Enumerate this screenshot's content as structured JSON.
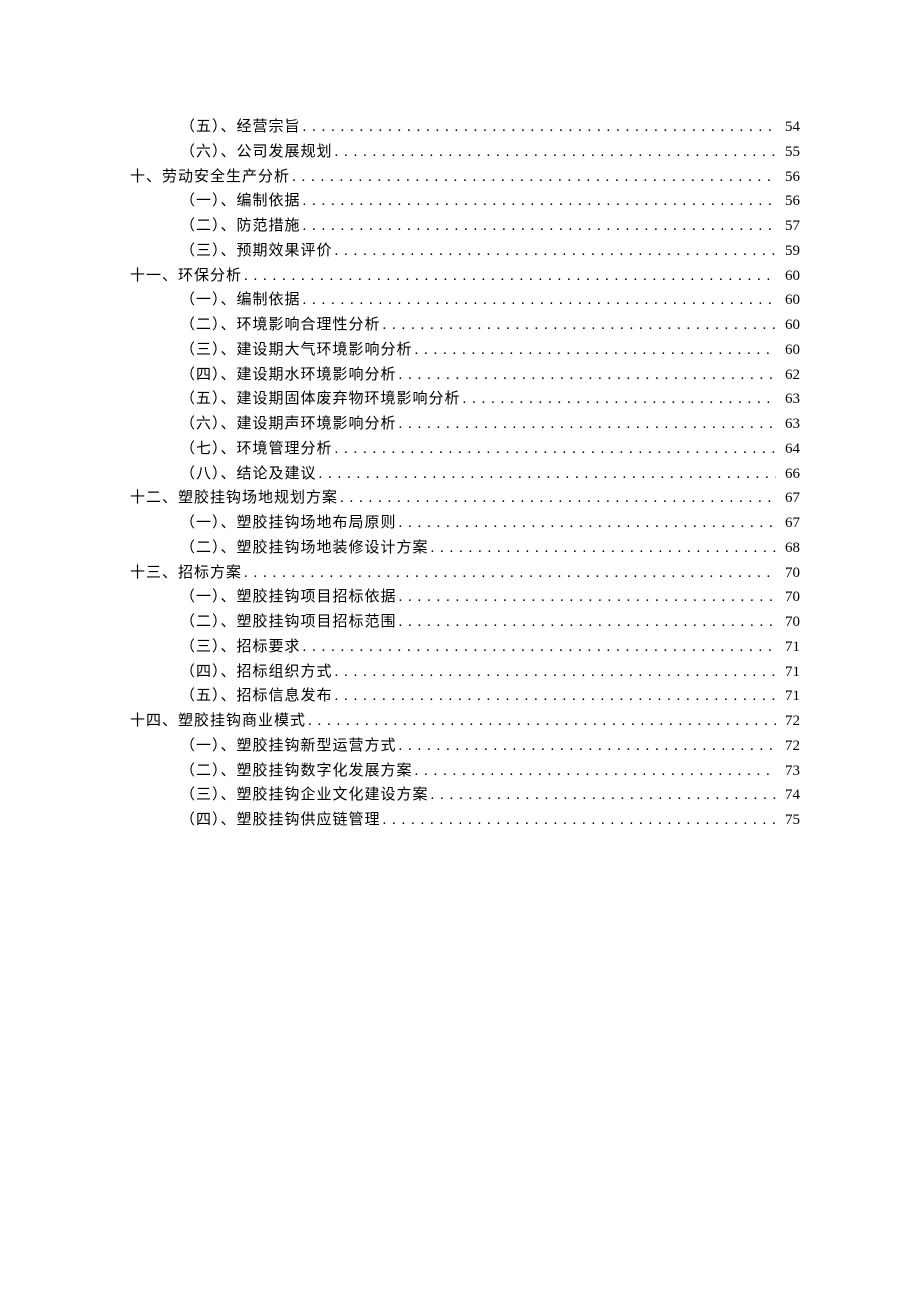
{
  "toc": [
    {
      "level": "sub",
      "label": "（五）、经营宗旨",
      "page": "54"
    },
    {
      "level": "sub",
      "label": "（六）、公司发展规划",
      "page": "55"
    },
    {
      "level": "section",
      "label": "十、劳动安全生产分析",
      "page": "56"
    },
    {
      "level": "sub",
      "label": "（一）、编制依据",
      "page": "56"
    },
    {
      "level": "sub",
      "label": "（二）、防范措施",
      "page": "57"
    },
    {
      "level": "sub",
      "label": "（三）、预期效果评价",
      "page": "59"
    },
    {
      "level": "section",
      "label": "十一、环保分析",
      "page": "60"
    },
    {
      "level": "sub",
      "label": "（一）、编制依据",
      "page": "60"
    },
    {
      "level": "sub",
      "label": "（二）、环境影响合理性分析",
      "page": "60"
    },
    {
      "level": "sub",
      "label": "（三）、建设期大气环境影响分析",
      "page": "60"
    },
    {
      "level": "sub",
      "label": "（四）、建设期水环境影响分析",
      "page": "62"
    },
    {
      "level": "sub",
      "label": "（五）、建设期固体废弃物环境影响分析",
      "page": "63"
    },
    {
      "level": "sub",
      "label": "（六）、建设期声环境影响分析",
      "page": "63"
    },
    {
      "level": "sub",
      "label": "（七）、环境管理分析",
      "page": "64"
    },
    {
      "level": "sub",
      "label": "（八）、结论及建议",
      "page": "66"
    },
    {
      "level": "section",
      "label": "十二、塑胶挂钩场地规划方案",
      "page": "67"
    },
    {
      "level": "sub",
      "label": "（一）、塑胶挂钩场地布局原则",
      "page": "67"
    },
    {
      "level": "sub",
      "label": "（二）、塑胶挂钩场地装修设计方案",
      "page": "68"
    },
    {
      "level": "section",
      "label": "十三、招标方案",
      "page": "70"
    },
    {
      "level": "sub",
      "label": "（一）、塑胶挂钩项目招标依据",
      "page": "70"
    },
    {
      "level": "sub",
      "label": "（二）、塑胶挂钩项目招标范围",
      "page": "70"
    },
    {
      "level": "sub",
      "label": "（三）、招标要求",
      "page": "71"
    },
    {
      "level": "sub",
      "label": "（四）、招标组织方式",
      "page": "71"
    },
    {
      "level": "sub",
      "label": "（五）、招标信息发布",
      "page": "71"
    },
    {
      "level": "section",
      "label": "十四、塑胶挂钩商业模式",
      "page": "72"
    },
    {
      "level": "sub",
      "label": "（一）、塑胶挂钩新型运营方式",
      "page": "72"
    },
    {
      "level": "sub",
      "label": "（二）、塑胶挂钩数字化发展方案",
      "page": "73"
    },
    {
      "level": "sub",
      "label": "（三）、塑胶挂钩企业文化建设方案",
      "page": "74"
    },
    {
      "level": "sub",
      "label": "（四）、塑胶挂钩供应链管理",
      "page": "75"
    }
  ]
}
